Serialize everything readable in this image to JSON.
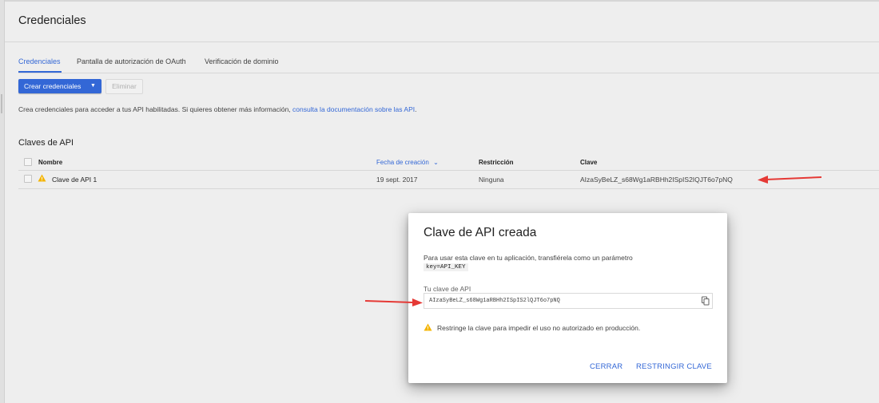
{
  "page": {
    "title": "Credenciales"
  },
  "tabs": [
    {
      "label": "Credenciales",
      "active": true
    },
    {
      "label": "Pantalla de autorización de OAuth",
      "active": false
    },
    {
      "label": "Verificación de dominio",
      "active": false
    }
  ],
  "toolbar": {
    "create_label": "Crear credenciales",
    "create_caret": "▼",
    "delete_label": "Eliminar"
  },
  "intro": {
    "text": "Crea credenciales para acceder a tus API habilitadas. Si quieres obtener más información,",
    "link": "consulta la documentación sobre las API",
    "suffix": "."
  },
  "api_keys": {
    "title": "Claves de API",
    "columns": {
      "name": "Nombre",
      "created": "Fecha de creación",
      "sort_indicator": "⌄",
      "restriction": "Restricción",
      "key": "Clave"
    },
    "rows": [
      {
        "name": "Clave de API 1",
        "created": "19 sept. 2017",
        "restriction": "Ninguna",
        "key": "AIzaSyBeLZ_s68Wg1aRBHh2ISpIS2IQJT6o7pNQ",
        "warning_icon": "warning-icon"
      }
    ]
  },
  "dialog": {
    "title": "Clave de API creada",
    "description": "Para usar esta clave en tu aplicación, transfiérela como un parámetro",
    "code": "key=API_KEY",
    "field_label": "Tu clave de API",
    "field_value": "AIzaSyBeLZ_s68Wg1aRBHh2ISpIS2lQJT6o7pNQ",
    "warning": "Restringe la clave para impedir el uso no autorizado en producción.",
    "close_label": "CERRAR",
    "restrict_label": "RESTRINGIR CLAVE"
  },
  "colors": {
    "accent": "#3367d6",
    "warning": "#f4b400",
    "annotation_arrow": "#e53935"
  }
}
